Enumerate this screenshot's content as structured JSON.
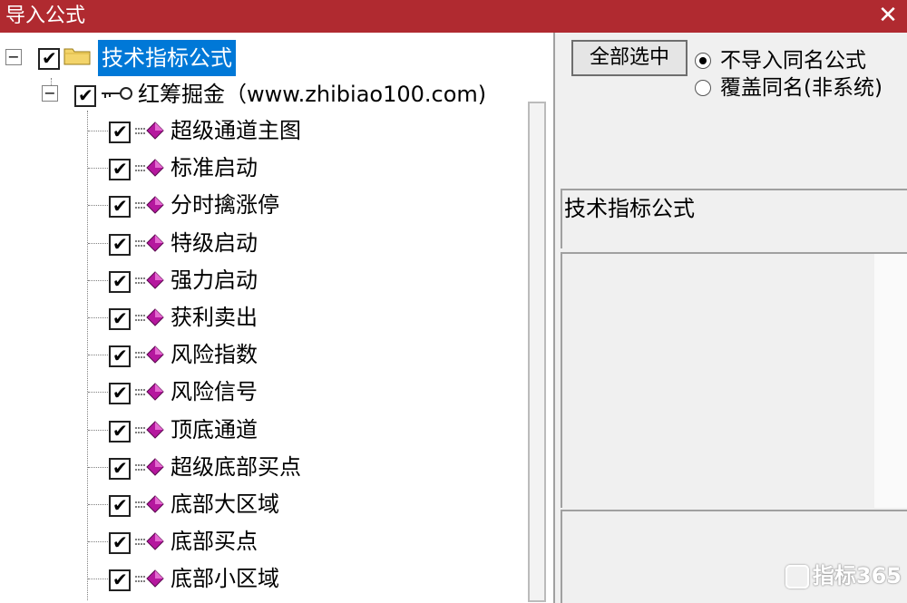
{
  "window": {
    "title": "导入公式",
    "close_glyph": "✕"
  },
  "tree": {
    "root": {
      "label": "技术指标公式",
      "checked": true,
      "icon": "folder-icon"
    },
    "group": {
      "label": "红筹掘金（www.zhibiao100.com)",
      "checked": true,
      "icon": "key-icon"
    },
    "items": [
      {
        "label": "超级通道主图"
      },
      {
        "label": "标准启动"
      },
      {
        "label": "分时擒涨停"
      },
      {
        "label": "特级启动"
      },
      {
        "label": "强力启动"
      },
      {
        "label": "获利卖出"
      },
      {
        "label": "风险指数"
      },
      {
        "label": "风险信号"
      },
      {
        "label": "顶底通道"
      },
      {
        "label": "超级底部买点"
      },
      {
        "label": "底部大区域"
      },
      {
        "label": "底部买点"
      },
      {
        "label": "底部小区域"
      }
    ],
    "expander_glyph": "−",
    "check_glyph": "✔"
  },
  "right": {
    "select_all_label": "全部选中",
    "radio_options": [
      {
        "label": "不导入同名公式",
        "selected": true
      },
      {
        "label": "覆盖同名(非系统)",
        "selected": false
      }
    ],
    "info_text": "技术指标公式"
  },
  "watermark": {
    "text": "指标365"
  },
  "colors": {
    "titlebar": "#b02a30",
    "selection": "#0078d7",
    "formula_icon": "#b5179e"
  }
}
